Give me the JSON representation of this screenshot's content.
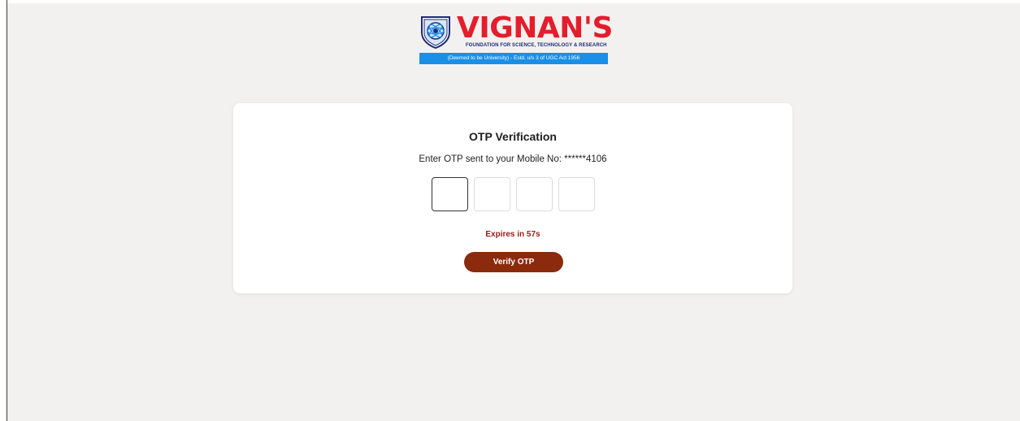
{
  "logo": {
    "title": "VIGNAN'S",
    "subtitle": "FOUNDATION FOR SCIENCE, TECHNOLOGY & RESEARCH",
    "band": "(Deemed to be University) - Estd. u/s 3 of UGC Act 1956",
    "brand_color": "#e41d2d",
    "band_color": "#1a8fe8"
  },
  "otp": {
    "title": "OTP Verification",
    "description": "Enter OTP sent to your Mobile No: ******4106",
    "digits": [
      "",
      "",
      "",
      ""
    ],
    "expires_text": "Expires in 57s",
    "verify_label": "Verify OTP",
    "button_color": "#8b2a0c",
    "expires_color": "#9b1b16"
  }
}
